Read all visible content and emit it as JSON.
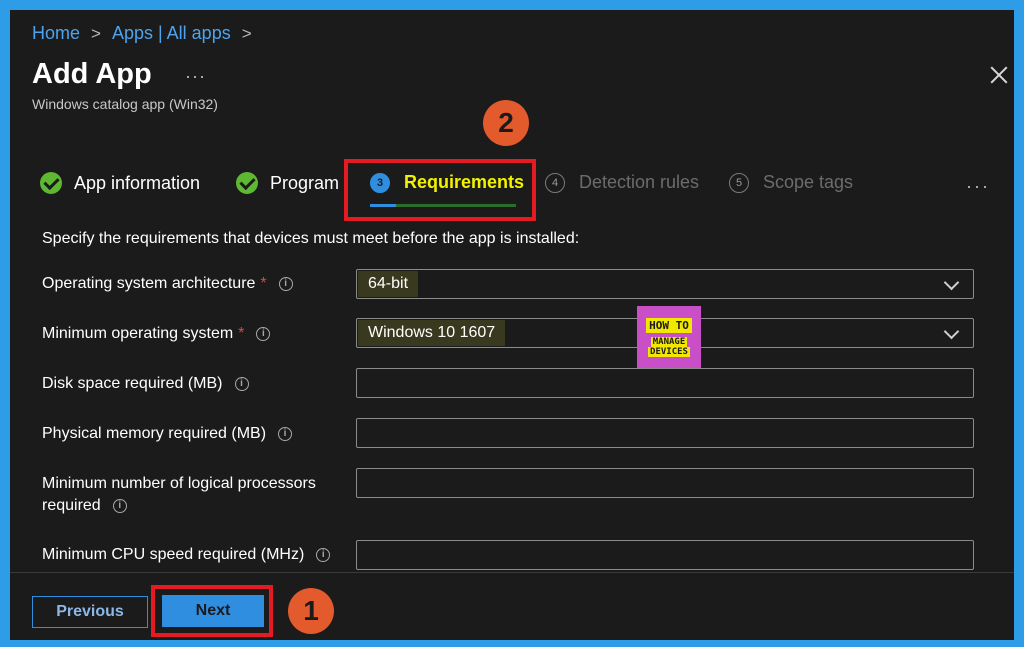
{
  "breadcrumb": {
    "home": "Home",
    "apps": "Apps | All apps"
  },
  "header": {
    "title": "Add App",
    "more": "···",
    "subtitle": "Windows catalog app (Win32)"
  },
  "callouts": {
    "requirements_step": "2",
    "next_button": "1"
  },
  "steps": [
    {
      "label": "App information",
      "state": "done"
    },
    {
      "label": "Program",
      "state": "done"
    },
    {
      "number": "3",
      "label": "Requirements",
      "state": "active"
    },
    {
      "number": "4",
      "label": "Detection rules",
      "state": "pending"
    },
    {
      "number": "5",
      "label": "Scope tags",
      "state": "pending"
    }
  ],
  "steps_more": "···",
  "intro": "Specify the requirements that devices must meet before the app is installed:",
  "fields": {
    "os_architecture": {
      "label": "Operating system architecture",
      "required": "*",
      "value": "64-bit"
    },
    "min_os": {
      "label": "Minimum operating system",
      "required": "*",
      "value": "Windows 10 1607"
    },
    "disk_space": {
      "label": "Disk space required (MB)",
      "value": ""
    },
    "physical_memory": {
      "label": "Physical memory required (MB)",
      "value": ""
    },
    "logical_processors": {
      "label_line1": "Minimum number of logical processors",
      "label_line2": "required",
      "value": ""
    },
    "cpu_speed": {
      "label": "Minimum CPU speed required (MHz)",
      "value": ""
    }
  },
  "watermark": {
    "line1": "HOW TO",
    "line2": "MANAGE",
    "line3": "DEVICES"
  },
  "footer": {
    "previous": "Previous",
    "next": "Next"
  },
  "colors": {
    "accent": "#2f8ee0",
    "highlight": "#e51b24",
    "callout": "#e35b2c",
    "active_step": "#f2f200",
    "success": "#5fb832"
  }
}
